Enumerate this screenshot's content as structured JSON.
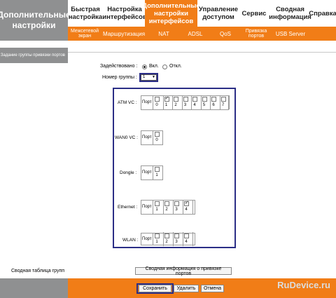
{
  "header": {
    "left_title": "Дополнительные настройки",
    "tabs": [
      {
        "label": "Быстрая настройка",
        "active": false
      },
      {
        "label": "Настройка интерфейсов",
        "active": false
      },
      {
        "label": "Дополнительные настройки интерфейсов",
        "active": true
      },
      {
        "label": "Управление доступом",
        "active": false
      },
      {
        "label": "Сервис",
        "active": false
      },
      {
        "label": "Сводная информация",
        "active": false
      },
      {
        "label": "Справка",
        "active": false
      }
    ],
    "subtabs": [
      "Межсетевой экран",
      "Маршрутизация",
      "NAT",
      "ADSL",
      "QoS",
      "Привязка портов",
      "USB Server"
    ]
  },
  "sidebar": {
    "section_title": "Задание группы привязки портов"
  },
  "form": {
    "enabled_label": "Задействовано :",
    "opt_on": "Вкл.",
    "opt_off": "Откл.",
    "group_label": "Номер группы :",
    "group_value": "1",
    "port_word": "Порт"
  },
  "ports": {
    "atm": {
      "label": "ATM VC :",
      "nums": [
        "0",
        "1",
        "2",
        "3",
        "4",
        "5",
        "6",
        "7"
      ],
      "checked": [
        1
      ]
    },
    "wan0": {
      "label": "WAN0 VC :",
      "nums": [
        "0"
      ],
      "checked": []
    },
    "dongle": {
      "label": "Dongle :",
      "nums": [
        "1"
      ],
      "checked": []
    },
    "ethernet": {
      "label": "Ethernet :",
      "nums": [
        "1",
        "2",
        "3",
        "4"
      ],
      "checked": [
        3
      ]
    },
    "wlan": {
      "label": "WLAN :",
      "nums": [
        "1",
        "2",
        "3",
        "4"
      ],
      "checked": []
    }
  },
  "summary": {
    "label": "Сводная таблица групп",
    "button": "Сводная информация о привязке портов"
  },
  "footer": {
    "save": "Сохранить",
    "delete": "Удалить",
    "cancel": "Отмена"
  },
  "watermark": "RuDevice.ru",
  "colors": {
    "accent": "#f17d17",
    "sidebar": "#8f9091",
    "highlight": "#2b2e86"
  }
}
